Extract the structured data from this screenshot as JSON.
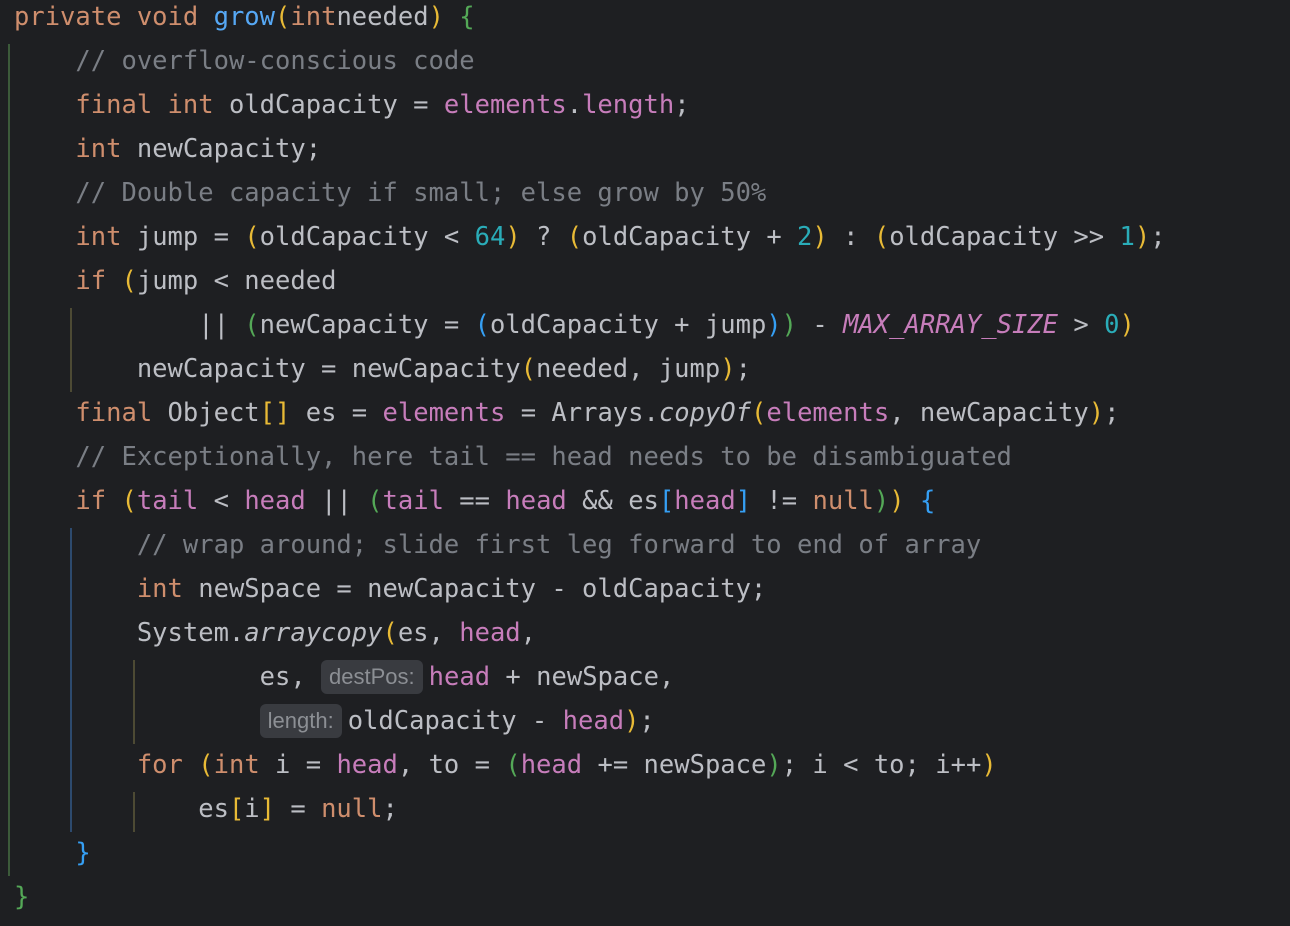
{
  "editor": {
    "code_lines": [
      [
        [
          "kw",
          "private void "
        ],
        [
          "fn",
          "grow"
        ],
        [
          "b1",
          "("
        ],
        [
          "kw",
          "int"
        ],
        [
          "",
          "needed"
        ],
        [
          "b1",
          ")"
        ],
        [
          "",
          " "
        ],
        [
          "b2",
          "{"
        ]
      ],
      [
        [
          "",
          "    "
        ],
        [
          "cm",
          "// overflow-conscious code"
        ]
      ],
      [
        [
          "",
          "    "
        ],
        [
          "kw",
          "final int "
        ],
        [
          "",
          "oldCapacity = "
        ],
        [
          "fld",
          "elements"
        ],
        [
          "",
          "."
        ],
        [
          "fld",
          "length"
        ],
        [
          "",
          ";"
        ]
      ],
      [
        [
          "",
          "    "
        ],
        [
          "kw",
          "int "
        ],
        [
          "",
          "newCapacity;"
        ]
      ],
      [
        [
          "",
          "    "
        ],
        [
          "cm",
          "// Double capacity if small; else grow by 50%"
        ]
      ],
      [
        [
          "",
          "    "
        ],
        [
          "kw",
          "int "
        ],
        [
          "",
          "jump = "
        ],
        [
          "b1",
          "("
        ],
        [
          "",
          "oldCapacity < "
        ],
        [
          "num",
          "64"
        ],
        [
          "b1",
          ")"
        ],
        [
          "",
          " ? "
        ],
        [
          "b1",
          "("
        ],
        [
          "",
          "oldCapacity + "
        ],
        [
          "num",
          "2"
        ],
        [
          "b1",
          ")"
        ],
        [
          "",
          " : "
        ],
        [
          "b1",
          "("
        ],
        [
          "",
          "oldCapacity >> "
        ],
        [
          "num",
          "1"
        ],
        [
          "b1",
          ")"
        ],
        [
          "",
          ";"
        ]
      ],
      [
        [
          "",
          "    "
        ],
        [
          "kw",
          "if "
        ],
        [
          "b1",
          "("
        ],
        [
          "",
          "jump < needed"
        ]
      ],
      [
        [
          "",
          "            || "
        ],
        [
          "b2",
          "("
        ],
        [
          "",
          "newCapacity = "
        ],
        [
          "b3",
          "("
        ],
        [
          "",
          "oldCapacity + jump"
        ],
        [
          "b3",
          ")"
        ],
        [
          "b2",
          ")"
        ],
        [
          "",
          " - "
        ],
        [
          "con",
          "MAX_ARRAY_SIZE"
        ],
        [
          "",
          " > "
        ],
        [
          "num",
          "0"
        ],
        [
          "b1",
          ")"
        ]
      ],
      [
        [
          "",
          "        newCapacity = newCapacity"
        ],
        [
          "b1",
          "("
        ],
        [
          "",
          "needed, jump"
        ],
        [
          "b1",
          ")"
        ],
        [
          "",
          ";"
        ]
      ],
      [
        [
          "",
          "    "
        ],
        [
          "kw",
          "final "
        ],
        [
          "",
          "Object"
        ],
        [
          "b1",
          "[]"
        ],
        [
          "",
          " es = "
        ],
        [
          "fld",
          "elements"
        ],
        [
          "",
          " = Arrays."
        ],
        [
          "sm",
          "copyOf"
        ],
        [
          "b1",
          "("
        ],
        [
          "fld",
          "elements"
        ],
        [
          "",
          ", newCapacity"
        ],
        [
          "b1",
          ")"
        ],
        [
          "",
          ";"
        ]
      ],
      [
        [
          "",
          "    "
        ],
        [
          "cm",
          "// Exceptionally, here tail == head needs to be disambiguated"
        ]
      ],
      [
        [
          "",
          "    "
        ],
        [
          "kw",
          "if "
        ],
        [
          "b1",
          "("
        ],
        [
          "fld",
          "tail"
        ],
        [
          "",
          " < "
        ],
        [
          "fld",
          "head"
        ],
        [
          "",
          " || "
        ],
        [
          "b2",
          "("
        ],
        [
          "fld",
          "tail"
        ],
        [
          "",
          " == "
        ],
        [
          "fld",
          "head"
        ],
        [
          "",
          " && es"
        ],
        [
          "b3",
          "["
        ],
        [
          "fld",
          "head"
        ],
        [
          "b3",
          "]"
        ],
        [
          "",
          " != "
        ],
        [
          "kw",
          "null"
        ],
        [
          "b2",
          ")"
        ],
        [
          "b1",
          ")"
        ],
        [
          "",
          " "
        ],
        [
          "b3",
          "{"
        ]
      ],
      [
        [
          "",
          "        "
        ],
        [
          "cm",
          "// wrap around; slide first leg forward to end of array"
        ]
      ],
      [
        [
          "",
          "        "
        ],
        [
          "kw",
          "int "
        ],
        [
          "",
          "newSpace = newCapacity - oldCapacity;"
        ]
      ],
      [
        [
          "",
          "        System."
        ],
        [
          "sm",
          "arraycopy"
        ],
        [
          "b1",
          "("
        ],
        [
          "",
          "es, "
        ],
        [
          "fld",
          "head"
        ],
        [
          "",
          ","
        ]
      ],
      [
        [
          "",
          "                es, "
        ],
        [
          "hint",
          "destPos:"
        ],
        [
          "fld",
          "head"
        ],
        [
          "",
          " + newSpace,"
        ]
      ],
      [
        [
          "",
          "                "
        ],
        [
          "hint",
          "length:"
        ],
        [
          "",
          "oldCapacity - "
        ],
        [
          "fld",
          "head"
        ],
        [
          "b1",
          ")"
        ],
        [
          "",
          ";"
        ]
      ],
      [
        [
          "",
          "        "
        ],
        [
          "kw",
          "for "
        ],
        [
          "b1",
          "("
        ],
        [
          "kw",
          "int "
        ],
        [
          "",
          "i = "
        ],
        [
          "fld",
          "head"
        ],
        [
          "",
          ", to = "
        ],
        [
          "b2",
          "("
        ],
        [
          "fld",
          "head"
        ],
        [
          "",
          " += newSpace"
        ],
        [
          "b2",
          ")"
        ],
        [
          "",
          "; i < to; i++"
        ],
        [
          "b1",
          ")"
        ]
      ],
      [
        [
          "",
          "            es"
        ],
        [
          "b1",
          "["
        ],
        [
          "",
          "i"
        ],
        [
          "b1",
          "]"
        ],
        [
          "",
          " = "
        ],
        [
          "kw",
          "null"
        ],
        [
          "",
          ";"
        ]
      ],
      [
        [
          "",
          "    "
        ],
        [
          "b3",
          "}"
        ]
      ],
      [
        [
          "b2",
          "}"
        ]
      ]
    ],
    "indent_guides": [
      {
        "col": 0,
        "from": 1,
        "to": 19,
        "color": "#3c5a3a"
      },
      {
        "col": 4,
        "from": 7,
        "to": 8,
        "color": "#4d4a34"
      },
      {
        "col": 4,
        "from": 12,
        "to": 18,
        "color": "#2d4a6e"
      },
      {
        "col": 8,
        "from": 15,
        "to": 16,
        "color": "#4d4a34"
      },
      {
        "col": 8,
        "from": 18,
        "to": 18,
        "color": "#4d4a34"
      }
    ]
  }
}
